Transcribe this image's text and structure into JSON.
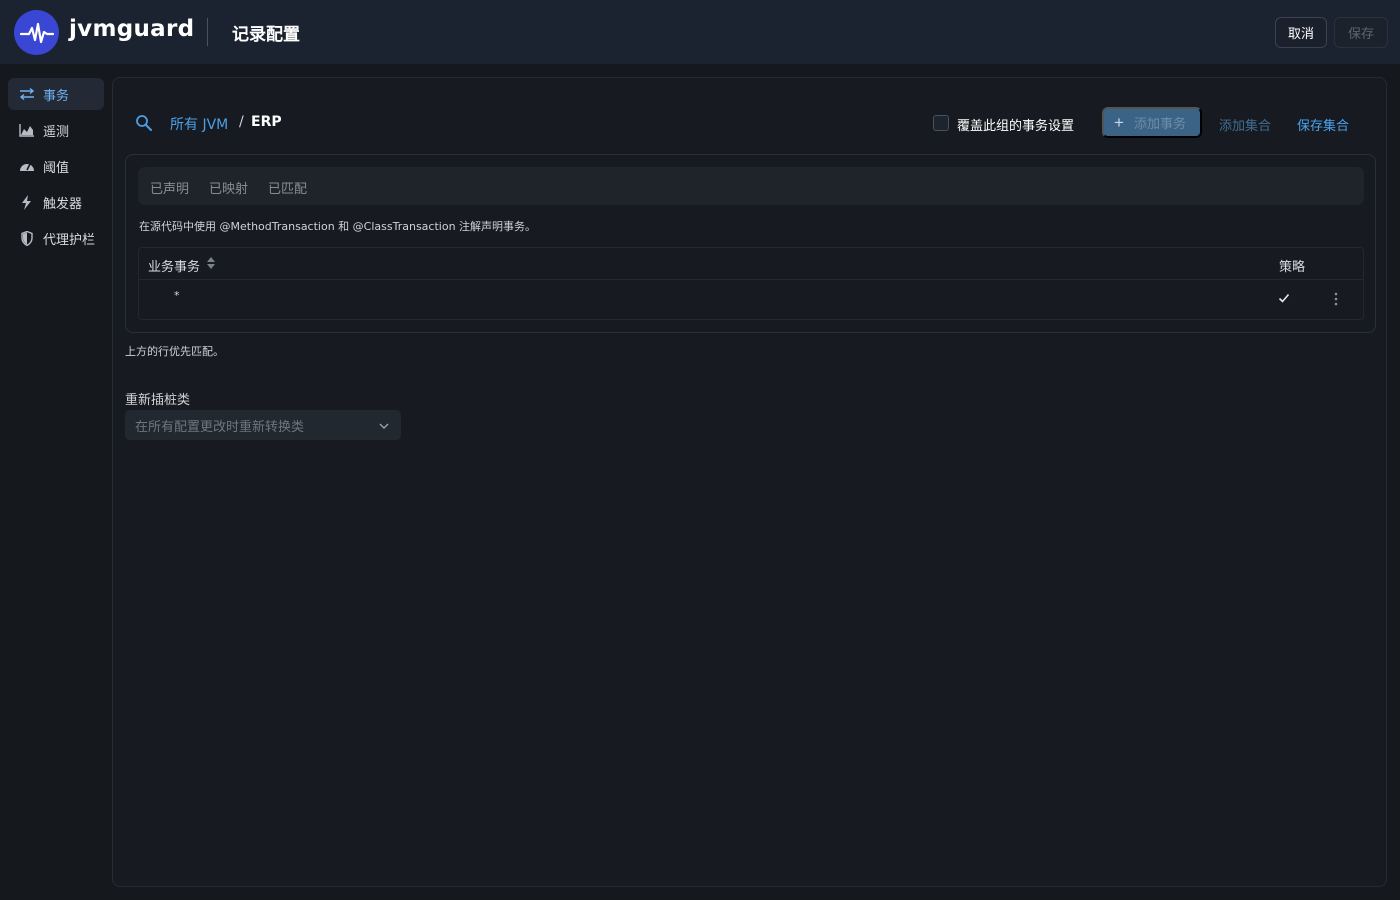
{
  "header": {
    "brand": "jvmguard",
    "title": "记录配置",
    "cancel_label": "取消",
    "save_label": "保存"
  },
  "sidebar": {
    "items": [
      {
        "label": "事务",
        "icon": "transactions-icon",
        "active": true
      },
      {
        "label": "遥测",
        "icon": "telemetry-chart-icon",
        "active": false
      },
      {
        "label": "阈值",
        "icon": "gauge-icon",
        "active": false
      },
      {
        "label": "触发器",
        "icon": "lightning-icon",
        "active": false
      },
      {
        "label": "代理护栏",
        "icon": "shield-icon",
        "active": false
      }
    ]
  },
  "breadcrumb": {
    "link": "所有 JVM",
    "separator": "/",
    "current": "ERP"
  },
  "toolbar": {
    "override_label": "覆盖此组的事务设置",
    "override_checked": false,
    "add_transaction_label": "添加事务",
    "add_collection_label": "添加集合",
    "save_collection_label": "保存集合"
  },
  "tabs": [
    "已声明",
    "已映射",
    "已匹配"
  ],
  "card": {
    "description": "在源代码中使用 @MethodTransaction 和 @ClassTransaction 注解声明事务。"
  },
  "table": {
    "columns": [
      "业务事务",
      "策略"
    ],
    "rows": [
      {
        "name": "*",
        "strategy_enabled": true
      }
    ]
  },
  "footnote": "上方的行优先匹配。",
  "reinstrument": {
    "label": "重新插桩类",
    "value": "在所有配置更改时重新转换类"
  },
  "colors": {
    "accent": "#4a9fe8",
    "header_bg": "#1b2330",
    "logo": "#3a47d5"
  }
}
